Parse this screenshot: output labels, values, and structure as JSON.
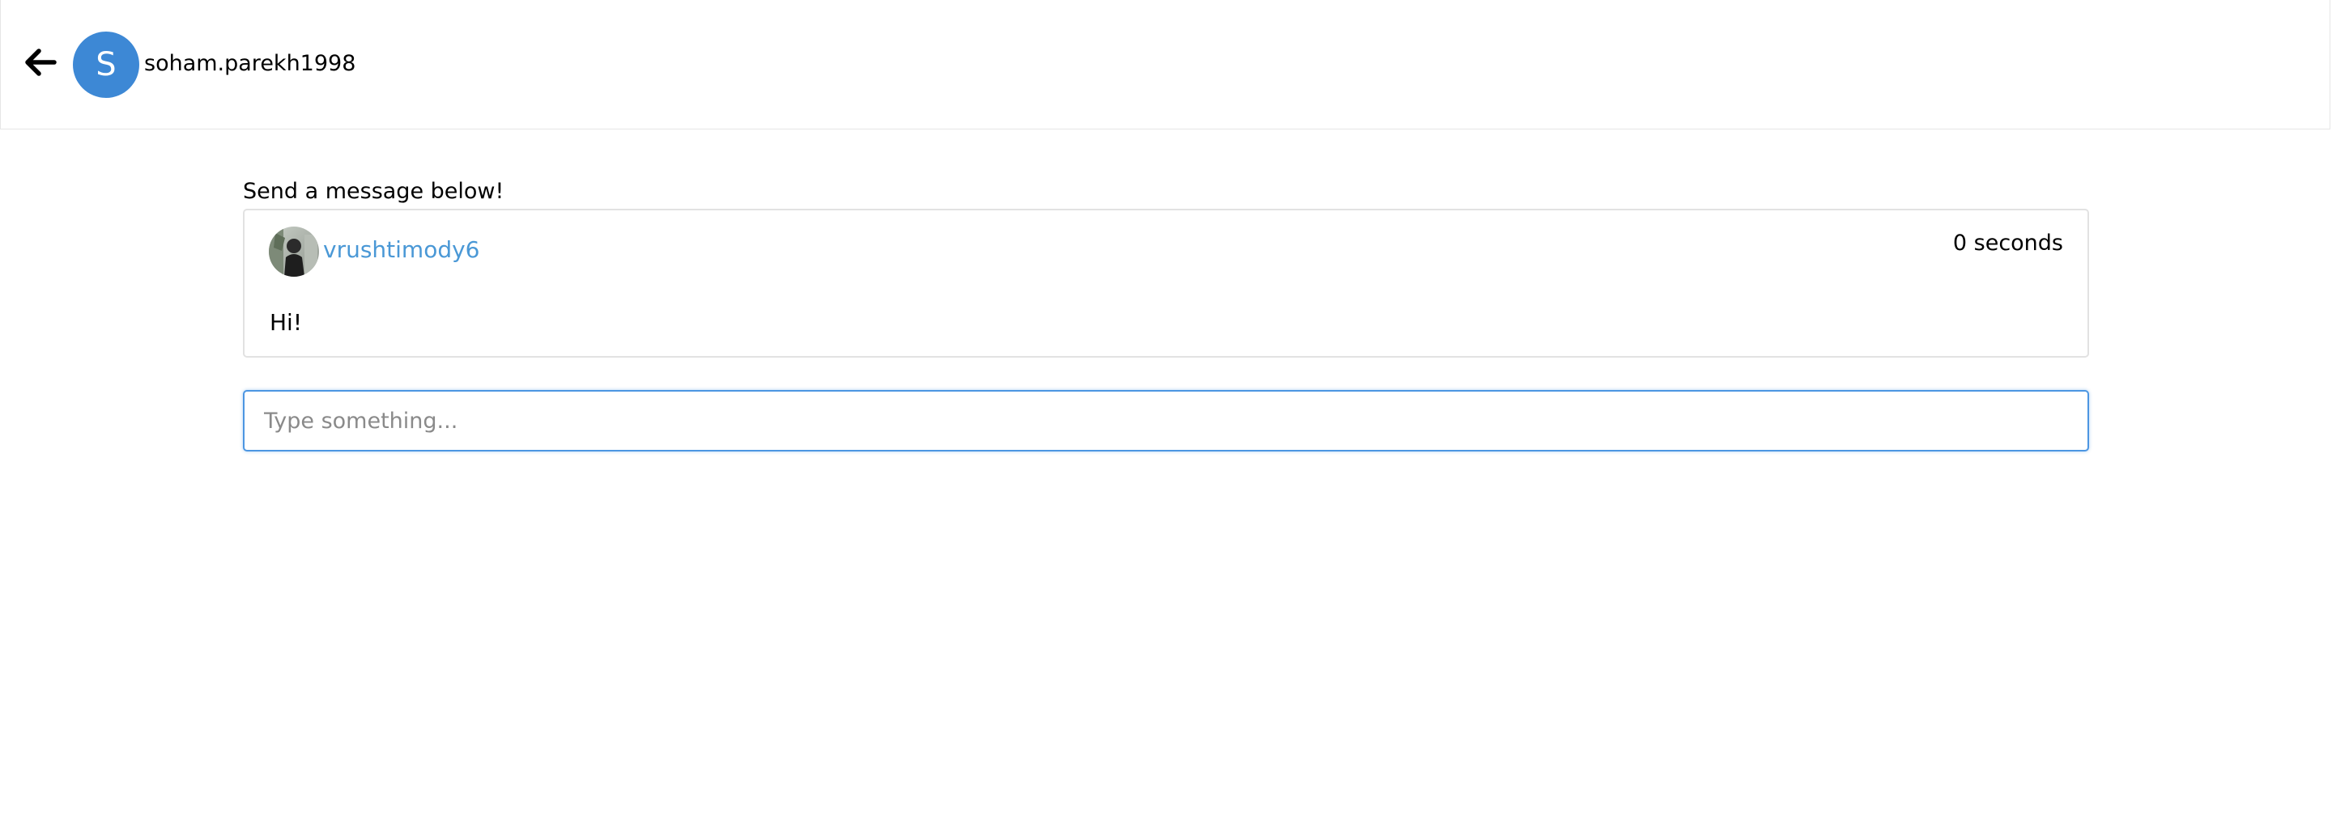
{
  "header": {
    "avatar_initial": "S",
    "username": "soham.parekh1998",
    "avatar_color": "#3d88d5"
  },
  "main": {
    "prompt": "Send a message below!",
    "messages": [
      {
        "sender": "vrushtimody6",
        "time": "0 seconds",
        "text": "Hi!"
      }
    ],
    "input": {
      "placeholder": "Type something...",
      "value": ""
    }
  },
  "colors": {
    "sender_link": "#4a98d6",
    "input_focus_border": "#4c96e2"
  },
  "icons": {
    "back": "arrow-left-icon",
    "sender_avatar": "profile-photo"
  }
}
